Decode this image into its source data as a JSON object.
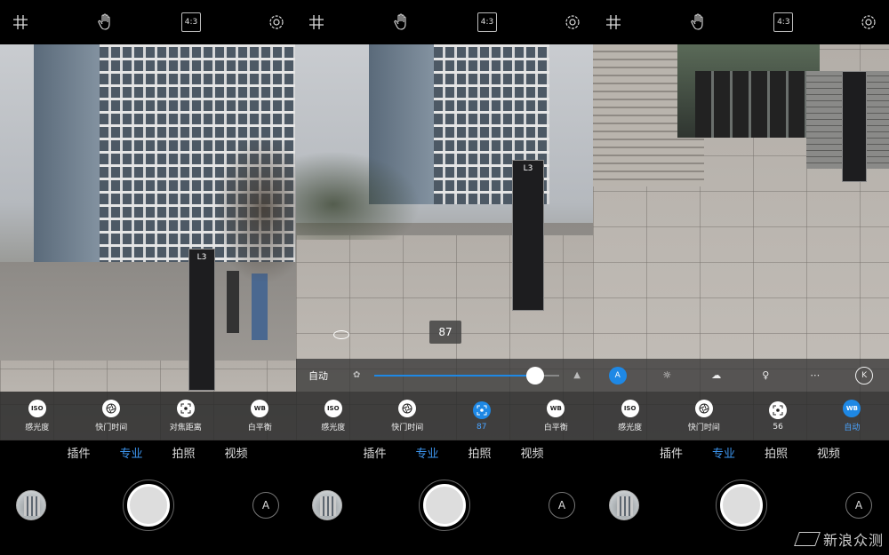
{
  "topbar": {
    "grid_icon": "grid-icon",
    "hand_icon": "hand-icon",
    "ratio": "4:3",
    "settings_icon": "gear-icon"
  },
  "modes": [
    "插件",
    "专业",
    "拍照",
    "视频"
  ],
  "active_mode": "专业",
  "panels": [
    {
      "controls": [
        {
          "icon": "ISO",
          "label": "感光度",
          "active": false
        },
        {
          "icon": "shutter-icon",
          "label": "快门时间",
          "active": false
        },
        {
          "icon": "focus-icon",
          "label": "对焦距离",
          "active": false
        },
        {
          "icon": "WB",
          "label": "白平衡",
          "active": false
        }
      ]
    },
    {
      "slider": {
        "label": "自动",
        "value": "87",
        "position": 0.87
      },
      "controls": [
        {
          "icon": "ISO",
          "label": "感光度",
          "active": false
        },
        {
          "icon": "shutter-icon",
          "label": "快门时间",
          "active": false
        },
        {
          "icon": "focus-icon",
          "label": "87",
          "active": true
        },
        {
          "icon": "WB",
          "label": "白平衡",
          "active": false
        }
      ]
    },
    {
      "wb_options": [
        "A",
        "sun-icon",
        "cloud-icon",
        "bulb-icon",
        "fluorescent-icon",
        "K"
      ],
      "controls": [
        {
          "icon": "ISO",
          "label": "感光度",
          "active": false
        },
        {
          "icon": "shutter-icon",
          "label": "快门时间",
          "active": false
        },
        {
          "icon": "focus-icon",
          "label": "56",
          "active": false
        },
        {
          "icon": "WB",
          "label": "自动",
          "active": true
        }
      ]
    }
  ],
  "bottom": {
    "auto_button": "A"
  },
  "watermark": "新浪众测",
  "colors": {
    "accent": "#1e88e5",
    "active_text": "#3d96f0"
  }
}
